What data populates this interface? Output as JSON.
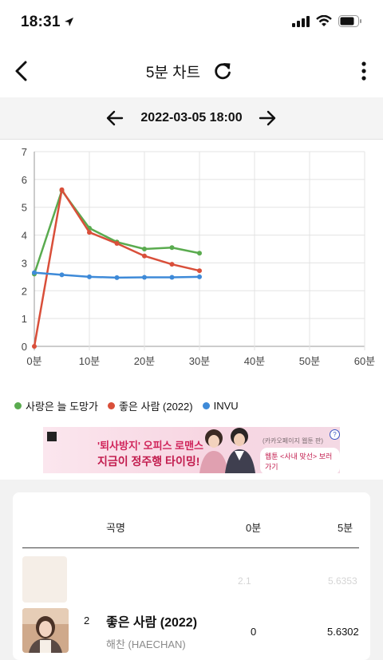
{
  "status_bar": {
    "time": "18:31"
  },
  "header": {
    "title": "5분 차트",
    "icons": [
      "back-arrow-icon",
      "refresh-icon",
      "more-vertical-icon"
    ]
  },
  "date_nav": {
    "date": "2022-03-05 18:00",
    "icons": [
      "arrow-left-icon",
      "arrow-right-icon"
    ]
  },
  "chart_data": {
    "type": "line",
    "x": [
      0,
      5,
      10,
      15,
      20,
      25,
      30
    ],
    "xticks": [
      "0분",
      "10분",
      "20분",
      "30분",
      "40분",
      "50분",
      "60분"
    ],
    "xlim": [
      0,
      60
    ],
    "ylim": [
      0,
      7
    ],
    "yticks": [
      "0",
      "1",
      "2",
      "3",
      "4",
      "5",
      "6",
      "7"
    ],
    "grid": true,
    "legend_position": "bottom-left",
    "series": [
      {
        "name": "사랑은 늘 도망가",
        "color": "#5aab4f",
        "values": [
          2.6,
          5.6,
          4.25,
          3.75,
          3.5,
          3.55,
          3.35
        ]
      },
      {
        "name": "좋은 사람 (2022)",
        "color": "#d94f3a",
        "values": [
          0,
          5.63,
          4.1,
          3.7,
          3.25,
          2.95,
          2.72
        ]
      },
      {
        "name": "INVU",
        "color": "#3e8ad8",
        "values": [
          2.65,
          2.57,
          2.5,
          2.47,
          2.48,
          2.48,
          2.5
        ]
      }
    ]
  },
  "ad": {
    "line1": "'퇴사방지' 오피스 로맨스",
    "line2": "지금이 정주행 타이밍!",
    "cta": "웹툰 <사내 맞선> 보러가기",
    "tag": "(카카오페이지 웹툰 판)"
  },
  "table": {
    "headers": [
      "곡명",
      "0분",
      "5분"
    ],
    "ghost_row": {
      "v0": "2.1",
      "v5": "5.6353"
    },
    "rows": [
      {
        "rank": "2",
        "song": "좋은 사람 (2022)",
        "artist": "해찬 (HAECHAN)",
        "v0": "0",
        "v5": "5.6302"
      }
    ]
  }
}
